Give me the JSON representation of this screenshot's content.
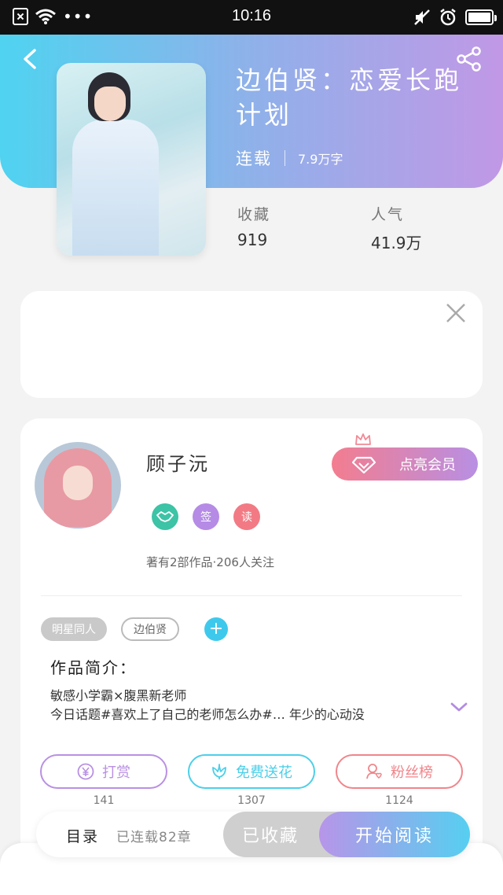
{
  "status_bar": {
    "time": "10:16"
  },
  "book": {
    "title": "边伯贤：恋爱长跑计划",
    "status": "连载",
    "word_count": "7.9万字",
    "stats": [
      {
        "label": "收藏",
        "value": "919"
      },
      {
        "label": "人气",
        "value": "41.9万"
      }
    ]
  },
  "author": {
    "name": "顾子沅",
    "vip_label": "点亮会员",
    "badges": [
      {
        "text": "",
        "color": "#3dc3a6"
      },
      {
        "text": "签",
        "color": "#b58be6"
      },
      {
        "text": "读",
        "color": "#f27a84"
      }
    ],
    "stats_text": "著有2部作品·206人关注"
  },
  "tags": [
    "明星同人",
    "边伯贤"
  ],
  "intro": {
    "title": "作品简介：",
    "lines": [
      "敏感小学霸×腹黑新老师",
      "今日话题#喜欢上了自己的老师怎么办#… 年少的心动没"
    ]
  },
  "actions": [
    {
      "label": "打赏",
      "count": "141",
      "color": "#b990e4"
    },
    {
      "label": "免费送花",
      "count": "1307",
      "color": "#4ccfe9"
    },
    {
      "label": "粉丝榜",
      "count": "1124",
      "color": "#f0868b"
    }
  ],
  "bottom_bar": {
    "toc_label": "目录",
    "chapter_count": "已连载82章",
    "collected_label": "已收藏",
    "read_label": "开始阅读"
  }
}
